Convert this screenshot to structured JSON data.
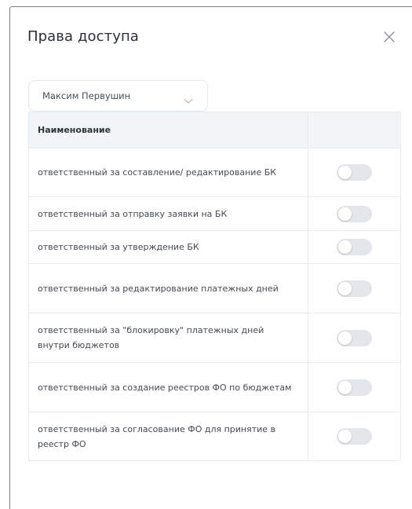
{
  "modal": {
    "title": "Права доступа",
    "close_icon": "close-icon"
  },
  "user_select": {
    "value": "Максим Первушин",
    "chevron_icon": "chevron-down-icon"
  },
  "table": {
    "header_name": "Наименование",
    "header_toggle": "",
    "rows": [
      {
        "label": "ответственный за составление/ редактирование БК",
        "enabled": false
      },
      {
        "label": "ответственный за отправку заявки на БК",
        "enabled": false
      },
      {
        "label": "ответственный за утверждение БК",
        "enabled": false
      },
      {
        "label": "ответственный за редактирование платежных дней",
        "enabled": false
      },
      {
        "label": "ответственный за \"блокировку\" платежных дней внутри бюджетов",
        "enabled": false
      },
      {
        "label": "ответственный за создание реестров ФО по бюджетам",
        "enabled": false
      },
      {
        "label": "ответственный за согласование ФО для принятие в реестр ФО",
        "enabled": false
      }
    ]
  },
  "colors": {
    "toggle_off": "#e3e6ea",
    "header_bg": "#f1f5f7",
    "border": "#e9ecef"
  }
}
